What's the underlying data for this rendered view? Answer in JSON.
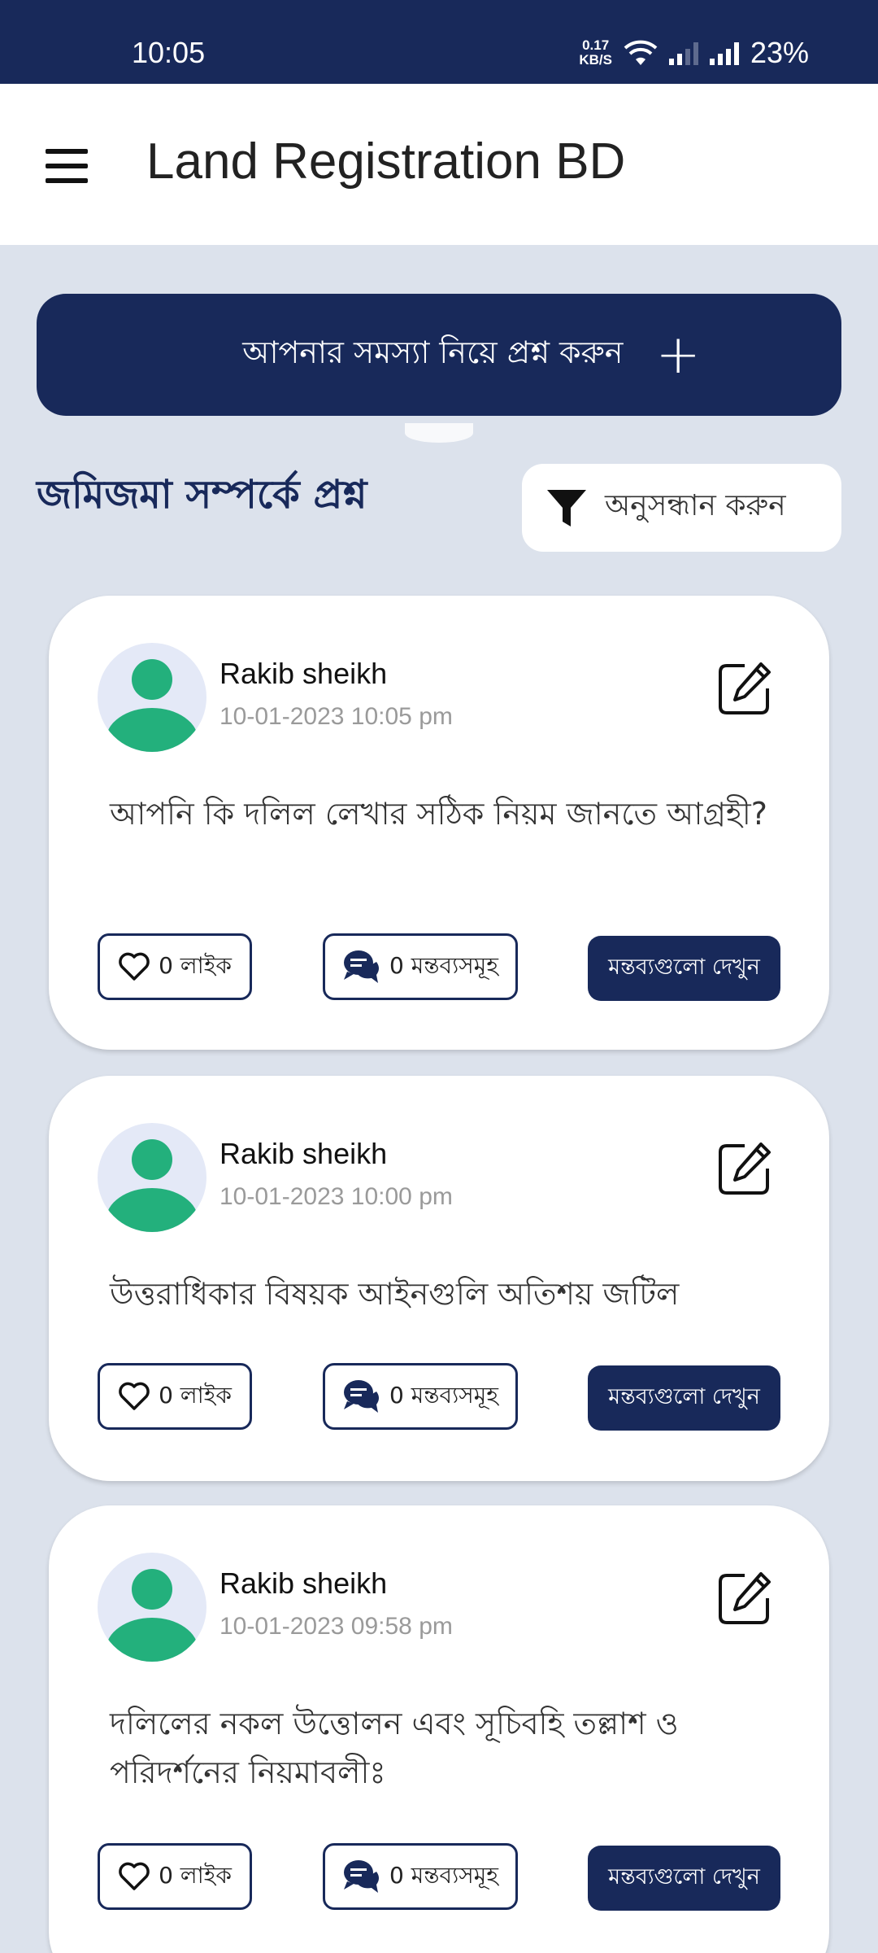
{
  "status_bar": {
    "time": "10:05",
    "net_speed_value": "0.17",
    "net_speed_unit": "KB/S",
    "battery": "23%"
  },
  "app_bar": {
    "title": "Land Registration BD",
    "menu_icon": "hamburger-menu-icon"
  },
  "ask_button": {
    "label": "আপনার সমস্যা নিয়ে প্রশ্ন করুন",
    "icon": "+"
  },
  "section": {
    "title": "জমিজমা সম্পর্কে প্রশ্ন",
    "filter_label": "অনুসন্ধান করুন",
    "filter_icon": "filter-icon"
  },
  "posts": [
    {
      "author": "Rakib sheikh",
      "timestamp": "10-01-2023 10:05 pm",
      "content": "আপনি কি দলিল লেখার সঠিক নিয়ম জানতে আগ্রহী?",
      "likes": "0 লাইক",
      "comments": "0 মন্তব্যসমূহ",
      "view_label": "মন্তব্যগুলো দেখুন"
    },
    {
      "author": "Rakib sheikh",
      "timestamp": "10-01-2023 10:00 pm",
      "content": "উত্তরাধিকার বিষয়ক আইনগুলি অতিশয় জটিল",
      "likes": "0 লাইক",
      "comments": "0 মন্তব্যসমূহ",
      "view_label": "মন্তব্যগুলো দেখুন"
    },
    {
      "author": "Rakib sheikh",
      "timestamp": "10-01-2023 09:58 pm",
      "content": "দলিলের নকল উত্তোলন এবং সূচিবহি তল্লাশ ও পরিদর্শনের নিয়মাবলীঃ",
      "likes": "0 লাইক",
      "comments": "0 মন্তব্যসমূহ",
      "view_label": "মন্তব্যগুলো দেখুন"
    }
  ],
  "colors": {
    "primary": "#18295a",
    "background": "#dce2ec",
    "avatar": "#23b07c"
  }
}
